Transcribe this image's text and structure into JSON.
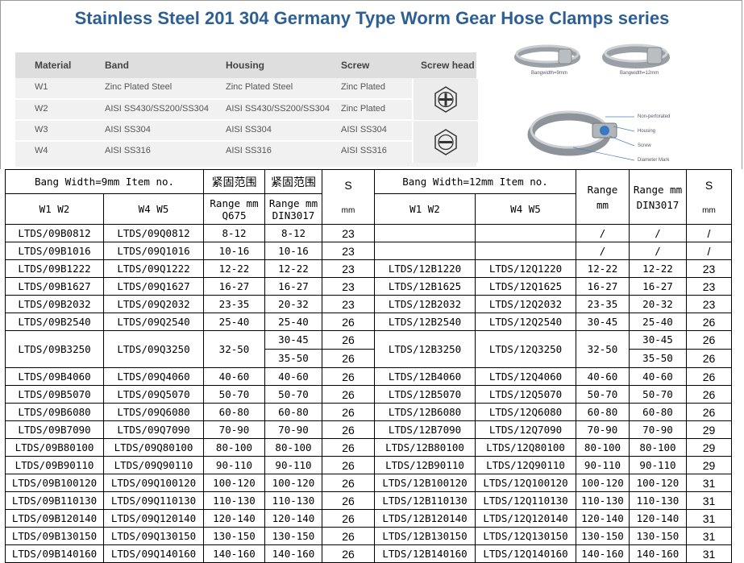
{
  "title": "Stainless Steel 201 304 Germany Type Worm Gear Hose Clamps series",
  "material_table": {
    "headers": [
      "Material",
      "Band",
      "Housing",
      "Screw",
      "Screw head"
    ],
    "rows": [
      [
        "W1",
        "Zinc Plated Steel",
        "Zinc Plated Steel",
        "Zinc Plated"
      ],
      [
        "W2",
        "AISI SS430/SS200/SS304",
        "AISI SS430/SS200/SS304",
        "Zinc Plated"
      ],
      [
        "W3",
        "AISI SS304",
        "AISI SS304",
        "AISI SS304"
      ],
      [
        "W4",
        "AISI SS316",
        "AISI SS316",
        "AISI SS316"
      ]
    ]
  },
  "photo_labels": {
    "bang9": "Bangwidth=9mm",
    "bang12": "Bangwidth=12mm",
    "non_perforated": "Non-perforated",
    "housing": "Housing",
    "screw": "Screw",
    "diameter_mark": "Diameter Mark"
  },
  "spec_table": {
    "h_bang9": "Bang Width=9mm Item no.",
    "h_bang12": "Bang Width=12mm Item no.",
    "h_cn": "紧固范围",
    "h_range_mm": "Range mm",
    "h_q675": "Q675",
    "h_din": "DIN3017",
    "h_s": "S",
    "h_mm": "mm",
    "h_range": "Range",
    "h_w1w2": "W1 W2",
    "h_w4w5": "W4  W5",
    "rows": [
      {
        "a": "LTDS/09B0812",
        "b": "LTDS/09Q0812",
        "r": "8-12",
        "d": [
          "8-12"
        ],
        "s": [
          "23"
        ],
        "c": "",
        "e": "",
        "r2": "/",
        "d2": [
          "/"
        ],
        "s2": [
          "/"
        ]
      },
      {
        "a": "LTDS/09B1016",
        "b": "LTDS/09Q1016",
        "r": "10-16",
        "d": [
          "10-16"
        ],
        "s": [
          "23"
        ],
        "c": "",
        "e": "",
        "r2": "/",
        "d2": [
          "/"
        ],
        "s2": [
          "/"
        ]
      },
      {
        "a": "LTDS/09B1222",
        "b": "LTDS/09Q1222",
        "r": "12-22",
        "d": [
          "12-22"
        ],
        "s": [
          "23"
        ],
        "c": "LTDS/12B1220",
        "e": "LTDS/12Q1220",
        "r2": "12-22",
        "d2": [
          "12-22"
        ],
        "s2": [
          "23"
        ]
      },
      {
        "a": "LTDS/09B1627",
        "b": "LTDS/09Q1627",
        "r": "16-27",
        "d": [
          "16-27"
        ],
        "s": [
          "23"
        ],
        "c": "LTDS/12B1625",
        "e": "LTDS/12Q1625",
        "r2": "16-27",
        "d2": [
          "16-27"
        ],
        "s2": [
          "23"
        ]
      },
      {
        "a": "LTDS/09B2032",
        "b": "LTDS/09Q2032",
        "r": "23-35",
        "d": [
          "20-32"
        ],
        "s": [
          "23"
        ],
        "c": "LTDS/12B2032",
        "e": "LTDS/12Q2032",
        "r2": "23-35",
        "d2": [
          "20-32"
        ],
        "s2": [
          "23"
        ]
      },
      {
        "a": "LTDS/09B2540",
        "b": "LTDS/09Q2540",
        "r": "25-40",
        "d": [
          "25-40"
        ],
        "s": [
          "26"
        ],
        "c": "LTDS/12B2540",
        "e": "LTDS/12Q2540",
        "r2": "30-45",
        "d2": [
          "25-40"
        ],
        "s2": [
          "26"
        ]
      },
      {
        "a": "LTDS/09B3250",
        "b": "LTDS/09Q3250",
        "r": "32-50",
        "d": [
          "30-45",
          "35-50"
        ],
        "s": [
          "26",
          "26"
        ],
        "c": "LTDS/12B3250",
        "e": "LTDS/12Q3250",
        "r2": "32-50",
        "d2": [
          "30-45",
          "35-50"
        ],
        "s2": [
          "26",
          "26"
        ]
      },
      {
        "a": "LTDS/09B4060",
        "b": "LTDS/09Q4060",
        "r": "40-60",
        "d": [
          "40-60"
        ],
        "s": [
          "26"
        ],
        "c": "LTDS/12B4060",
        "e": "LTDS/12Q4060",
        "r2": "40-60",
        "d2": [
          "40-60"
        ],
        "s2": [
          "26"
        ]
      },
      {
        "a": "LTDS/09B5070",
        "b": "LTDS/09Q5070",
        "r": "50-70",
        "d": [
          "50-70"
        ],
        "s": [
          "26"
        ],
        "c": "LTDS/12B5070",
        "e": "LTDS/12Q5070",
        "r2": "50-70",
        "d2": [
          "50-70"
        ],
        "s2": [
          "26"
        ]
      },
      {
        "a": "LTDS/09B6080",
        "b": "LTDS/09Q6080",
        "r": "60-80",
        "d": [
          "60-80"
        ],
        "s": [
          "26"
        ],
        "c": "LTDS/12B6080",
        "e": "LTDS/12Q6080",
        "r2": "60-80",
        "d2": [
          "60-80"
        ],
        "s2": [
          "26"
        ]
      },
      {
        "a": "LTDS/09B7090",
        "b": "LTDS/09Q7090",
        "r": "70-90",
        "d": [
          "70-90"
        ],
        "s": [
          "26"
        ],
        "c": "LTDS/12B7090",
        "e": "LTDS/12Q7090",
        "r2": "70-90",
        "d2": [
          "70-90"
        ],
        "s2": [
          "29"
        ]
      },
      {
        "a": "LTDS/09B80100",
        "b": "LTDS/09Q80100",
        "r": "80-100",
        "d": [
          "80-100"
        ],
        "s": [
          "26"
        ],
        "c": "LTDS/12B80100",
        "e": "LTDS/12Q80100",
        "r2": "80-100",
        "d2": [
          "80-100"
        ],
        "s2": [
          "29"
        ]
      },
      {
        "a": "LTDS/09B90110",
        "b": "LTDS/09Q90110",
        "r": "90-110",
        "d": [
          "90-110"
        ],
        "s": [
          "26"
        ],
        "c": "LTDS/12B90110",
        "e": "LTDS/12Q90110",
        "r2": "90-110",
        "d2": [
          "90-110"
        ],
        "s2": [
          "29"
        ]
      },
      {
        "a": "LTDS/09B100120",
        "b": "LTDS/09Q100120",
        "r": "100-120",
        "d": [
          "100-120"
        ],
        "s": [
          "26"
        ],
        "c": "LTDS/12B100120",
        "e": "LTDS/12Q100120",
        "r2": "100-120",
        "d2": [
          "100-120"
        ],
        "s2": [
          "31"
        ]
      },
      {
        "a": "LTDS/09B110130",
        "b": "LTDS/09Q110130",
        "r": "110-130",
        "d": [
          "110-130"
        ],
        "s": [
          "26"
        ],
        "c": "LTDS/12B110130",
        "e": "LTDS/12Q110130",
        "r2": "110-130",
        "d2": [
          "110-130"
        ],
        "s2": [
          "31"
        ]
      },
      {
        "a": "LTDS/09B120140",
        "b": "LTDS/09Q120140",
        "r": "120-140",
        "d": [
          "120-140"
        ],
        "s": [
          "26"
        ],
        "c": "LTDS/12B120140",
        "e": "LTDS/12Q120140",
        "r2": "120-140",
        "d2": [
          "120-140"
        ],
        "s2": [
          "31"
        ]
      },
      {
        "a": "LTDS/09B130150",
        "b": "LTDS/09Q130150",
        "r": "130-150",
        "d": [
          "130-150"
        ],
        "s": [
          "26"
        ],
        "c": "LTDS/12B130150",
        "e": "LTDS/12Q130150",
        "r2": "130-150",
        "d2": [
          "130-150"
        ],
        "s2": [
          "31"
        ]
      },
      {
        "a": "LTDS/09B140160",
        "b": "LTDS/09Q140160",
        "r": "140-160",
        "d": [
          "140-160"
        ],
        "s": [
          "26"
        ],
        "c": "LTDS/12B140160",
        "e": "LTDS/12Q140160",
        "r2": "140-160",
        "d2": [
          "140-160"
        ],
        "s2": [
          "31"
        ]
      }
    ]
  },
  "colors": {
    "title": "#2d5f93",
    "header_bg": "#dedede",
    "body_bg": "#f1f1f1"
  }
}
